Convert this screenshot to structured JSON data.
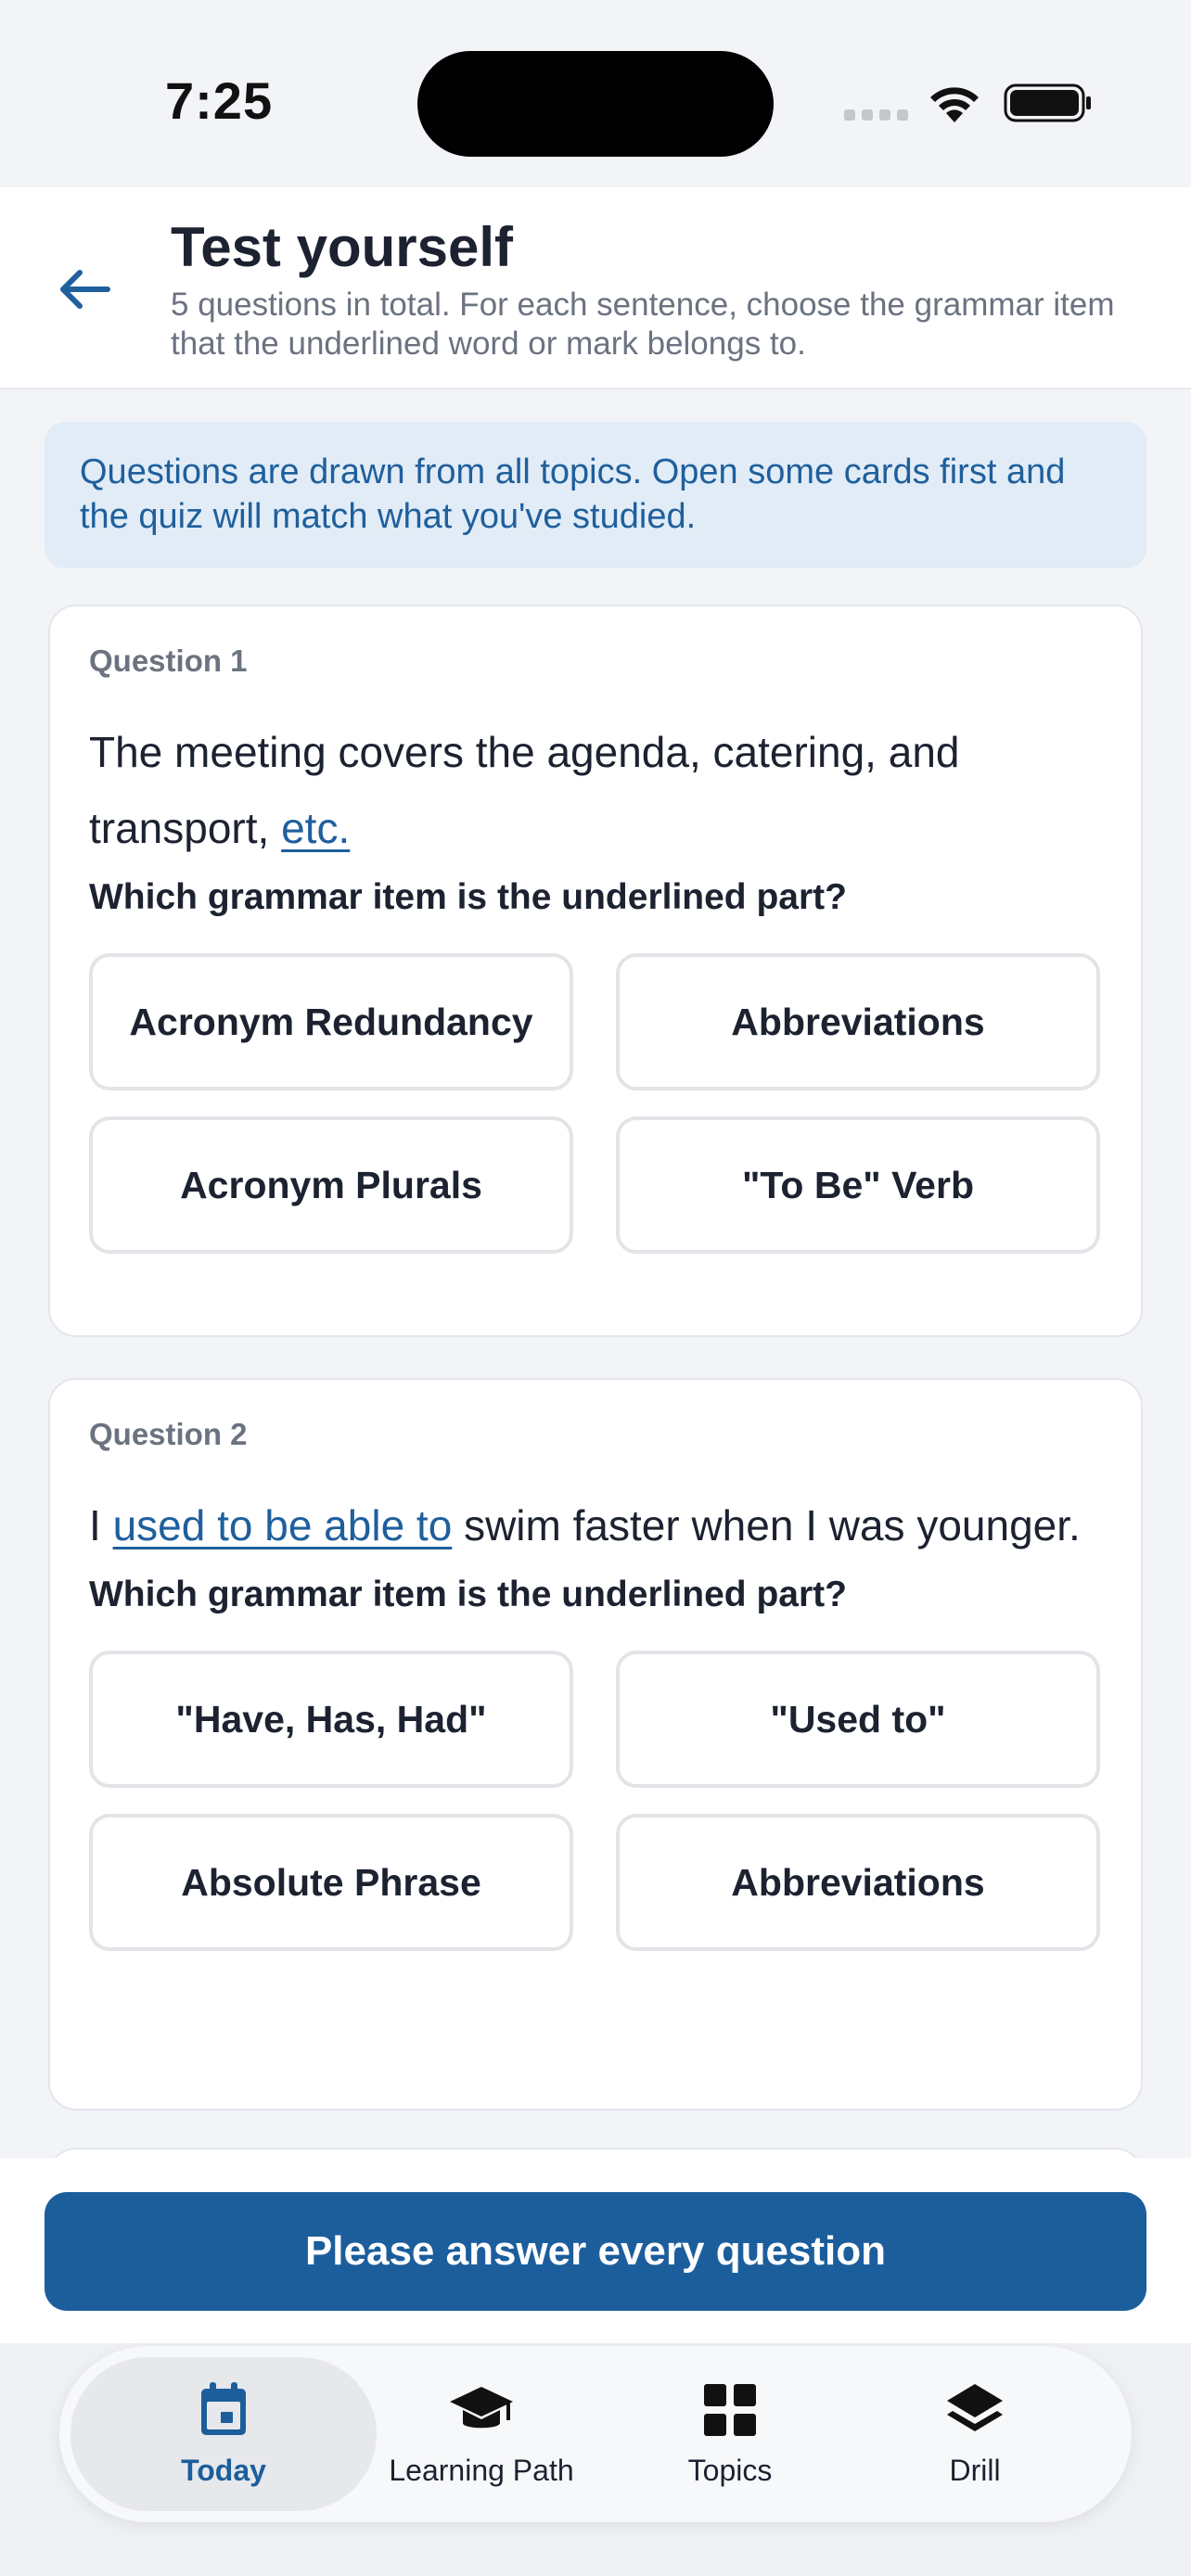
{
  "status_bar": {
    "time": "7:25"
  },
  "header": {
    "title": "Test yourself",
    "subtitle": "5 questions in total. For each sentence, choose the grammar item that the underlined word or mark belongs to."
  },
  "info_banner": "Questions are drawn from all topics. Open some cards first and the quiz will match what you've studied.",
  "questions": [
    {
      "number_label": "Question 1",
      "sentence_before": "The meeting covers the agenda, catering, and transport, ",
      "sentence_highlight": "etc.",
      "sentence_after": "",
      "prompt": "Which grammar item is the underlined part?",
      "options": [
        "Acronym Redundancy",
        "Abbreviations",
        "Acronym Plurals",
        "\"To Be\" Verb"
      ]
    },
    {
      "number_label": "Question 2",
      "sentence_before": "I ",
      "sentence_highlight": "used to be able to",
      "sentence_after": " swim faster when I was younger.",
      "prompt": "Which grammar item is the underlined part?",
      "options": [
        "\"Have, Has, Had\"",
        "\"Used to\"",
        "Absolute Phrase",
        "Abbreviations"
      ]
    }
  ],
  "footer": {
    "submit_label": "Please answer every question"
  },
  "tabs": [
    {
      "label": "Today",
      "icon": "calendar-icon",
      "active": true
    },
    {
      "label": "Learning Path",
      "icon": "graduation-cap-icon",
      "active": false
    },
    {
      "label": "Topics",
      "icon": "grid-icon",
      "active": false
    },
    {
      "label": "Drill",
      "icon": "layers-icon",
      "active": false
    }
  ],
  "colors": {
    "accent": "#1c5e9c",
    "link": "#1f5f9c",
    "banner_bg": "#e1ecf7",
    "page_bg": "#f2f4f7"
  }
}
